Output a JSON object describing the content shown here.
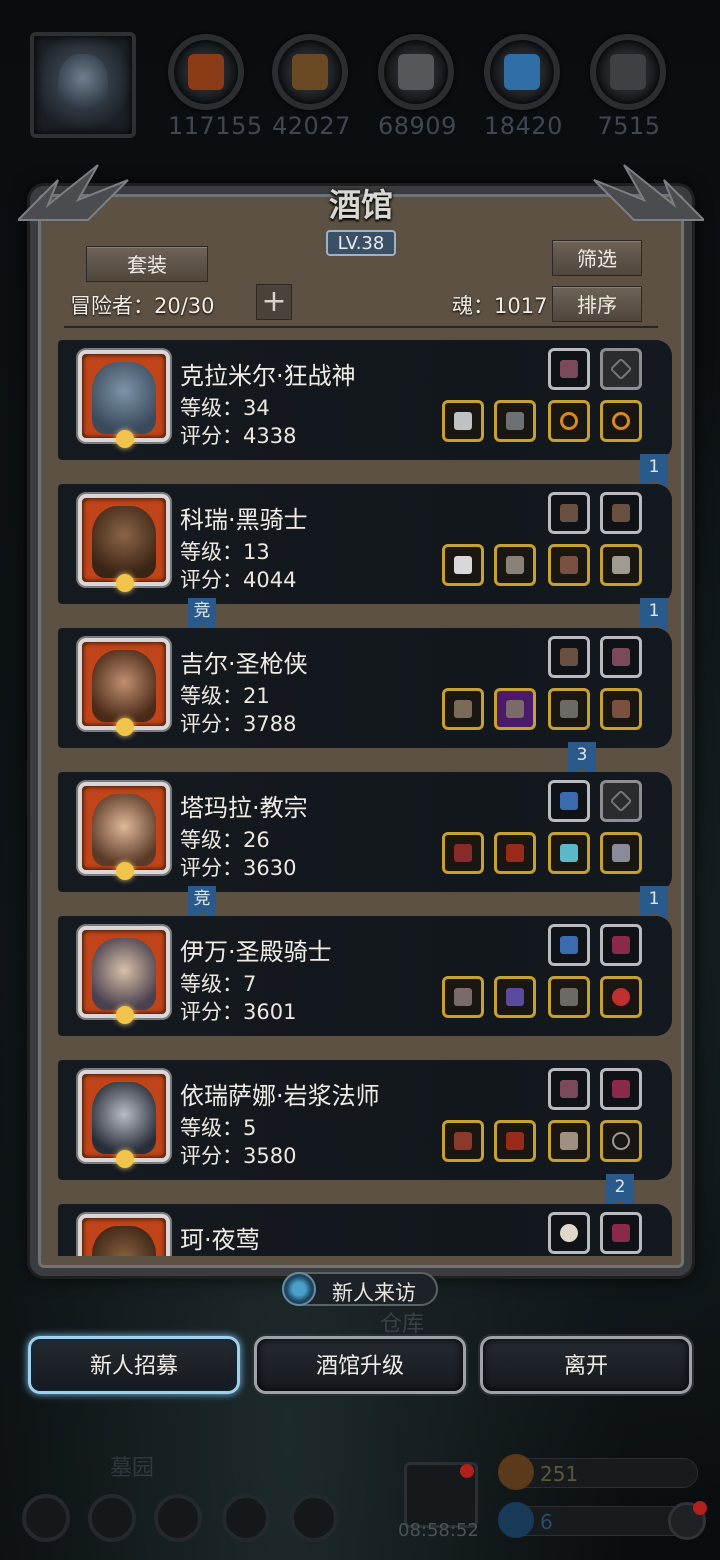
{
  "resources": [
    {
      "name": "meat",
      "value": "117155",
      "color": "#a5461c"
    },
    {
      "name": "wood",
      "value": "42027",
      "color": "#7a5a30"
    },
    {
      "name": "iron",
      "value": "68909",
      "color": "#6c6f72"
    },
    {
      "name": "crystal",
      "value": "18420",
      "color": "#3f8ac8"
    },
    {
      "name": "steel",
      "value": "7515",
      "color": "#505356"
    }
  ],
  "tavern": {
    "title": "酒馆",
    "level": "LV.38",
    "set_button": "套装",
    "filter_button": "筛选",
    "sort_button": "排序",
    "adventurers": "冒险者：20/30",
    "soul": "魂：1017"
  },
  "heroes": [
    {
      "name": "克拉米尔·狂战神",
      "level": "等级：34",
      "score": "评分：4338",
      "face": "#5a6f86",
      "badge": "1",
      "compete": ""
    },
    {
      "name": "科瑞·黑骑士",
      "level": "等级：13",
      "score": "评分：4044",
      "face": "#5b3a24",
      "badge": "1",
      "compete": "竞"
    },
    {
      "name": "吉尔·圣枪侠",
      "level": "等级：21",
      "score": "评分：3788",
      "face": "#6b4a2a",
      "badge": "3",
      "compete": ""
    },
    {
      "name": "塔玛拉·教宗",
      "level": "等级：26",
      "score": "评分：3630",
      "face": "#8a6a4c",
      "badge": "1",
      "compete": "竞"
    },
    {
      "name": "伊万·圣殿骑士",
      "level": "等级：7",
      "score": "评分：3601",
      "face": "#9a8070",
      "badge": "",
      "compete": ""
    },
    {
      "name": "依瑞萨娜·岩浆法师",
      "level": "等级：5",
      "score": "评分：3580",
      "face": "#4a4e5a",
      "badge": "2",
      "compete": ""
    },
    {
      "name": "珂·夜莺",
      "level": "",
      "score": "",
      "face": "#5a3a2a",
      "badge": "",
      "compete": ""
    }
  ],
  "visitor_label": "新人来访",
  "warehouse_label": "仓库",
  "buttons": {
    "recruit": "新人招募",
    "upgrade": "酒馆升级",
    "leave": "离开"
  },
  "hud": {
    "graveyard": "墓园",
    "timer": "08:58:52",
    "gold": "251",
    "gems": "6"
  },
  "colors": {
    "panel_bg": "#5d5143",
    "card_bg": "#151a20",
    "gold_slot": "#c4a130",
    "badge": "#2a5a8c"
  }
}
